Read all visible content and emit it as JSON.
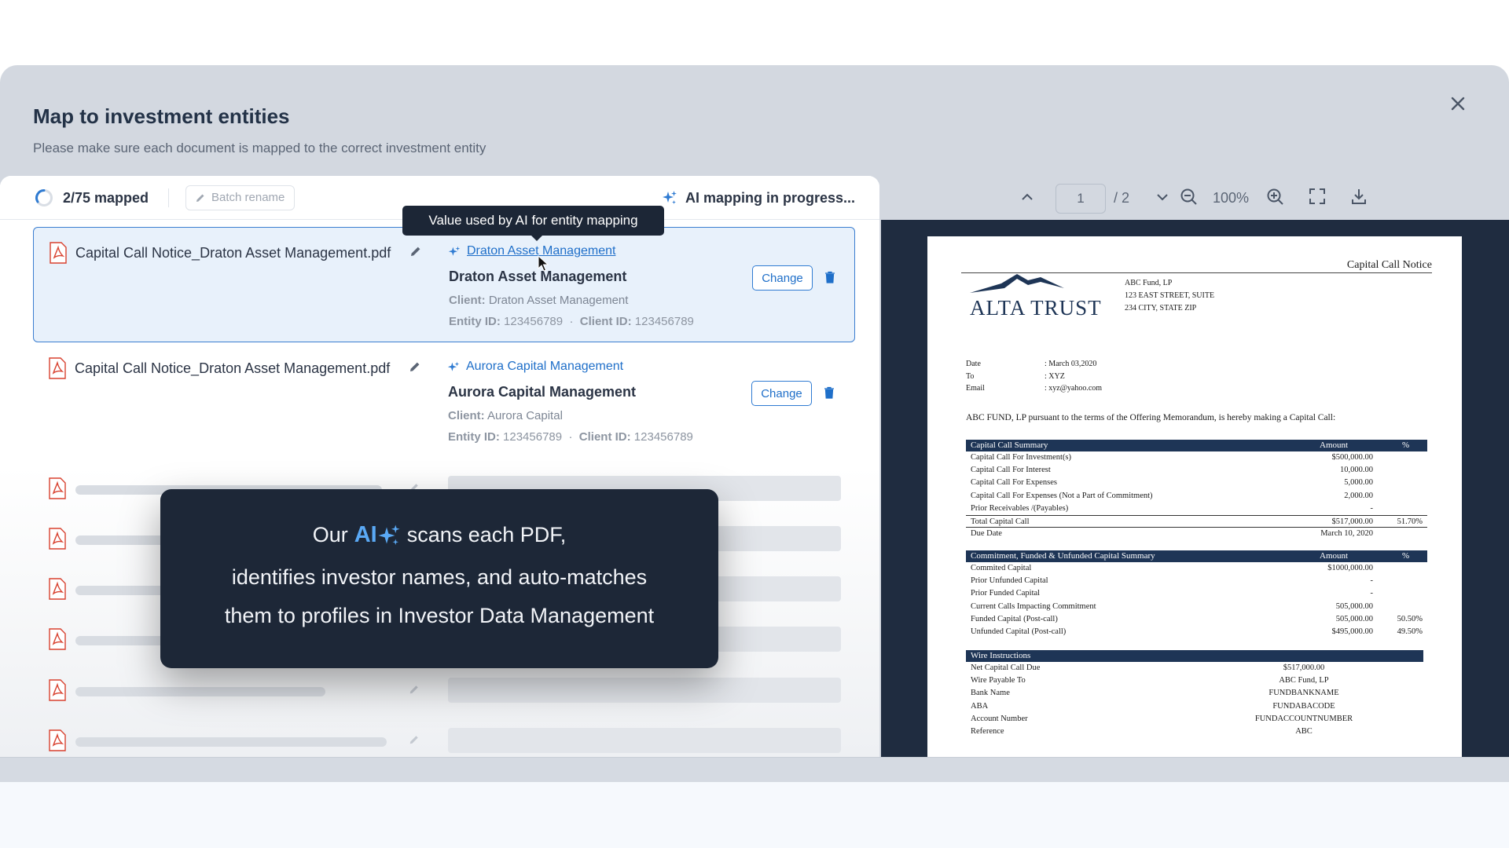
{
  "modal": {
    "title": "Map to investment entities",
    "subtitle": "Please make sure each document is mapped to the correct investment entity"
  },
  "toolbar": {
    "mapped_count": "2/75 mapped",
    "batch_rename_label": "Batch rename",
    "ai_status": "AI mapping in progress..."
  },
  "tooltip": "Value used by AI for entity mapping",
  "rows": [
    {
      "file_name": "Capital Call Notice_Draton Asset Management.pdf",
      "ai_value": "Draton Asset Management",
      "entity_name": "Draton Asset Management",
      "client_label": "Client:",
      "client_value": "Draton Asset Management",
      "entity_id_label": "Entity ID:",
      "entity_id": "123456789",
      "client_id_label": "Client ID:",
      "client_id": "123456789",
      "change_label": "Change"
    },
    {
      "file_name": "Capital Call Notice_Draton Asset Management.pdf",
      "ai_value": "Aurora Capital Management",
      "entity_name": "Aurora Capital Management",
      "client_label": "Client:",
      "client_value": "Aurora Capital",
      "entity_id_label": "Entity ID:",
      "entity_id": "123456789",
      "client_id_label": "Client ID:",
      "client_id": "123456789",
      "change_label": "Change"
    }
  ],
  "callout": {
    "prefix": "Our",
    "ai": "AI",
    "suffix": "scans each PDF,",
    "line2": "identifies investor names, and auto-matches",
    "line3": "them to profiles in Investor Data Management"
  },
  "viewer": {
    "page": "1",
    "total": "/ 2",
    "zoom": "100%"
  },
  "pdf": {
    "title": "Capital Call Notice",
    "logo_text": "ALTA TRUST",
    "address": [
      "ABC Fund, LP",
      "123  EAST  STREET,  SUITE",
      "234 CITY, STATE ZIP"
    ],
    "meta": [
      {
        "k": "Date",
        "v": ": March 03,2020"
      },
      {
        "k": "To",
        "v": ": XYZ"
      },
      {
        "k": "Email",
        "v": ": xyz@yahoo.com"
      }
    ],
    "intro": "ABC FUND, LP  pursuant to the terms of the Offering Memorandum, is hereby making a Capital Call:",
    "summary": {
      "head": [
        "Capital Call Summary",
        "Amount",
        "%"
      ],
      "rows": [
        {
          "label": "Capital Call For Investment(s)",
          "amount": "$500,000.00",
          "pct": ""
        },
        {
          "label": "Capital Call For Interest",
          "amount": "10,000.00",
          "pct": ""
        },
        {
          "label": "Capital Call For Expenses",
          "amount": "5,000.00",
          "pct": ""
        },
        {
          "label": "Capital Call For Expenses (Not a Part of Commitment)",
          "amount": "2,000.00",
          "pct": ""
        },
        {
          "label": "Prior Receivables /(Payables)",
          "amount": "-",
          "pct": ""
        }
      ],
      "total": {
        "label": "Total Capital Call",
        "amount": "$517,000.00",
        "pct": "51.70%"
      },
      "due": {
        "label": "Due Date",
        "amount": "March 10, 2020",
        "pct": ""
      }
    },
    "commitment": {
      "head": [
        "Commitment, Funded & Unfunded Capital Summary",
        "Amount",
        "%"
      ],
      "rows": [
        {
          "label": "Commited Capital",
          "amount": "$1000,000.00",
          "pct": ""
        },
        {
          "label": "Prior Unfunded Capital",
          "amount": "-",
          "pct": ""
        },
        {
          "label": "Prior Funded Capital",
          "amount": "-",
          "pct": ""
        },
        {
          "label": "Current Calls Impacting Commitment",
          "amount": "505,000.00",
          "pct": ""
        },
        {
          "label": "Funded Capital (Post-call)",
          "amount": "505,000.00",
          "pct": "50.50%"
        },
        {
          "label": "Unfunded Capital (Post-call)",
          "amount": "$495,000.00",
          "pct": "49.50%"
        }
      ]
    },
    "wire": {
      "head": "Wire Instructions",
      "rows": [
        {
          "label": "Net Capital Call Due",
          "value": "$517,000.00"
        },
        {
          "label": "Wire Payable To",
          "value": "ABC Fund, LP"
        },
        {
          "label": "Bank Name",
          "value": "FUNDBANKNAME"
        },
        {
          "label": "ABA",
          "value": "FUNDABACODE"
        },
        {
          "label": "Account Number",
          "value": "FUNDACCOUNTNUMBER"
        },
        {
          "label": "Reference",
          "value": "ABC"
        }
      ]
    }
  },
  "colors": {
    "accent": "#1f6fc9",
    "pdf_red": "#d8412f",
    "dark": "#1d2737"
  }
}
